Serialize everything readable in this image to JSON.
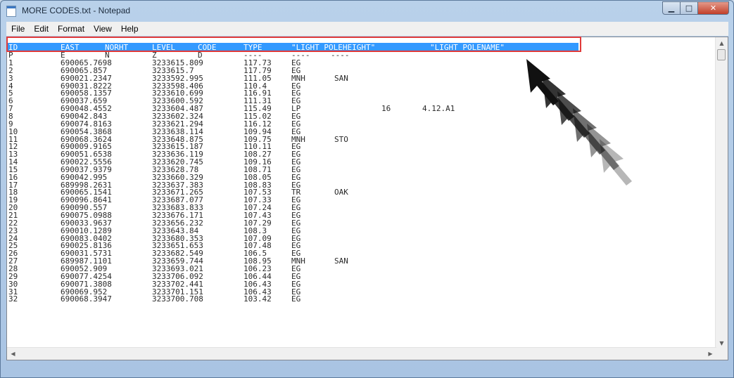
{
  "window": {
    "title": "MORE CODES.txt - Notepad"
  },
  "menu": [
    "File",
    "Edit",
    "Format",
    "View",
    "Help"
  ],
  "header": {
    "id": "ID",
    "east": "EAST",
    "norht": "NORHT",
    "level": "LEVEL",
    "code": "CODE",
    "type": "TYPE",
    "pole_height": "\"LIGHT POLEHEIGHT\"",
    "pole_name": "\"LIGHT POLENAME\""
  },
  "subheader": {
    "id": "P",
    "east": "E",
    "norht": "N",
    "level": "Z",
    "code": "D",
    "type": "----",
    "pole_height": "----",
    "pole_name": "----"
  },
  "rows": [
    {
      "id": "1",
      "east": "690065.7698",
      "north": "3233615.809",
      "level": "117.73",
      "code": "EG",
      "type": "",
      "pole_height": "",
      "pole_name": ""
    },
    {
      "id": "2",
      "east": "690065.857",
      "north": "3233615.7",
      "level": "117.79",
      "code": "EG",
      "type": "",
      "pole_height": "",
      "pole_name": ""
    },
    {
      "id": "3",
      "east": "690021.2347",
      "north": "3233592.995",
      "level": "111.05",
      "code": "MNH",
      "type": "SAN",
      "pole_height": "",
      "pole_name": ""
    },
    {
      "id": "4",
      "east": "690031.8222",
      "north": "3233598.406",
      "level": "110.4",
      "code": "EG",
      "type": "",
      "pole_height": "",
      "pole_name": ""
    },
    {
      "id": "5",
      "east": "690058.1357",
      "north": "3233610.699",
      "level": "116.91",
      "code": "EG",
      "type": "",
      "pole_height": "",
      "pole_name": ""
    },
    {
      "id": "6",
      "east": "690037.659",
      "north": "3233600.592",
      "level": "111.31",
      "code": "EG",
      "type": "",
      "pole_height": "",
      "pole_name": ""
    },
    {
      "id": "7",
      "east": "690048.4552",
      "north": "3233604.487",
      "level": "115.49",
      "code": "LP",
      "type": "",
      "pole_height": "16",
      "pole_name": "4.12.A1"
    },
    {
      "id": "8",
      "east": "690042.843",
      "north": "3233602.324",
      "level": "115.02",
      "code": "EG",
      "type": "",
      "pole_height": "",
      "pole_name": ""
    },
    {
      "id": "9",
      "east": "690074.8163",
      "north": "3233621.294",
      "level": "116.12",
      "code": "EG",
      "type": "",
      "pole_height": "",
      "pole_name": ""
    },
    {
      "id": "10",
      "east": "690054.3868",
      "north": "3233638.114",
      "level": "109.94",
      "code": "EG",
      "type": "",
      "pole_height": "",
      "pole_name": ""
    },
    {
      "id": "11",
      "east": "690068.3624",
      "north": "3233648.875",
      "level": "109.75",
      "code": "MNH",
      "type": "STO",
      "pole_height": "",
      "pole_name": ""
    },
    {
      "id": "12",
      "east": "690009.9165",
      "north": "3233615.187",
      "level": "110.11",
      "code": "EG",
      "type": "",
      "pole_height": "",
      "pole_name": ""
    },
    {
      "id": "13",
      "east": "690051.6538",
      "north": "3233636.119",
      "level": "108.27",
      "code": "EG",
      "type": "",
      "pole_height": "",
      "pole_name": ""
    },
    {
      "id": "14",
      "east": "690022.5556",
      "north": "3233620.745",
      "level": "109.16",
      "code": "EG",
      "type": "",
      "pole_height": "",
      "pole_name": ""
    },
    {
      "id": "15",
      "east": "690037.9379",
      "north": "3233628.78",
      "level": "108.71",
      "code": "EG",
      "type": "",
      "pole_height": "",
      "pole_name": ""
    },
    {
      "id": "16",
      "east": "690042.995",
      "north": "3233660.329",
      "level": "108.05",
      "code": "EG",
      "type": "",
      "pole_height": "",
      "pole_name": ""
    },
    {
      "id": "17",
      "east": "689998.2631",
      "north": "3233637.383",
      "level": "108.83",
      "code": "EG",
      "type": "",
      "pole_height": "",
      "pole_name": ""
    },
    {
      "id": "18",
      "east": "690065.1541",
      "north": "3233671.265",
      "level": "107.53",
      "code": "TR",
      "type": "OAK",
      "pole_height": "",
      "pole_name": ""
    },
    {
      "id": "19",
      "east": "690096.8641",
      "north": "3233687.077",
      "level": "107.33",
      "code": "EG",
      "type": "",
      "pole_height": "",
      "pole_name": ""
    },
    {
      "id": "20",
      "east": "690090.557",
      "north": "3233683.833",
      "level": "107.24",
      "code": "EG",
      "type": "",
      "pole_height": "",
      "pole_name": ""
    },
    {
      "id": "21",
      "east": "690075.0988",
      "north": "3233676.171",
      "level": "107.43",
      "code": "EG",
      "type": "",
      "pole_height": "",
      "pole_name": ""
    },
    {
      "id": "22",
      "east": "690033.9637",
      "north": "3233656.232",
      "level": "107.29",
      "code": "EG",
      "type": "",
      "pole_height": "",
      "pole_name": ""
    },
    {
      "id": "23",
      "east": "690010.1289",
      "north": "3233643.84",
      "level": "108.3",
      "code": "EG",
      "type": "",
      "pole_height": "",
      "pole_name": ""
    },
    {
      "id": "24",
      "east": "690083.0402",
      "north": "3233680.353",
      "level": "107.09",
      "code": "EG",
      "type": "",
      "pole_height": "",
      "pole_name": ""
    },
    {
      "id": "25",
      "east": "690025.8136",
      "north": "3233651.653",
      "level": "107.48",
      "code": "EG",
      "type": "",
      "pole_height": "",
      "pole_name": ""
    },
    {
      "id": "26",
      "east": "690031.5731",
      "north": "3233682.549",
      "level": "106.5",
      "code": "EG",
      "type": "",
      "pole_height": "",
      "pole_name": ""
    },
    {
      "id": "27",
      "east": "689987.1101",
      "north": "3233659.744",
      "level": "108.95",
      "code": "MNH",
      "type": "SAN",
      "pole_height": "",
      "pole_name": ""
    },
    {
      "id": "28",
      "east": "690052.909",
      "north": "3233693.021",
      "level": "106.23",
      "code": "EG",
      "type": "",
      "pole_height": "",
      "pole_name": ""
    },
    {
      "id": "29",
      "east": "690077.4254",
      "north": "3233706.092",
      "level": "106.44",
      "code": "EG",
      "type": "",
      "pole_height": "",
      "pole_name": ""
    },
    {
      "id": "30",
      "east": "690071.3808",
      "north": "3233702.441",
      "level": "106.43",
      "code": "EG",
      "type": "",
      "pole_height": "",
      "pole_name": ""
    },
    {
      "id": "31",
      "east": "690069.952",
      "north": "3233701.151",
      "level": "106.43",
      "code": "EG",
      "type": "",
      "pole_height": "",
      "pole_name": ""
    },
    {
      "id": "32",
      "east": "690068.3947",
      "north": "3233700.708",
      "level": "103.42",
      "code": "EG",
      "type": "",
      "pole_height": "",
      "pole_name": ""
    }
  ],
  "colors": {
    "selection": "#3399ff",
    "highlight_border": "#e03a3a"
  },
  "icons": {
    "annotation": "arrow-pointer-icon"
  }
}
